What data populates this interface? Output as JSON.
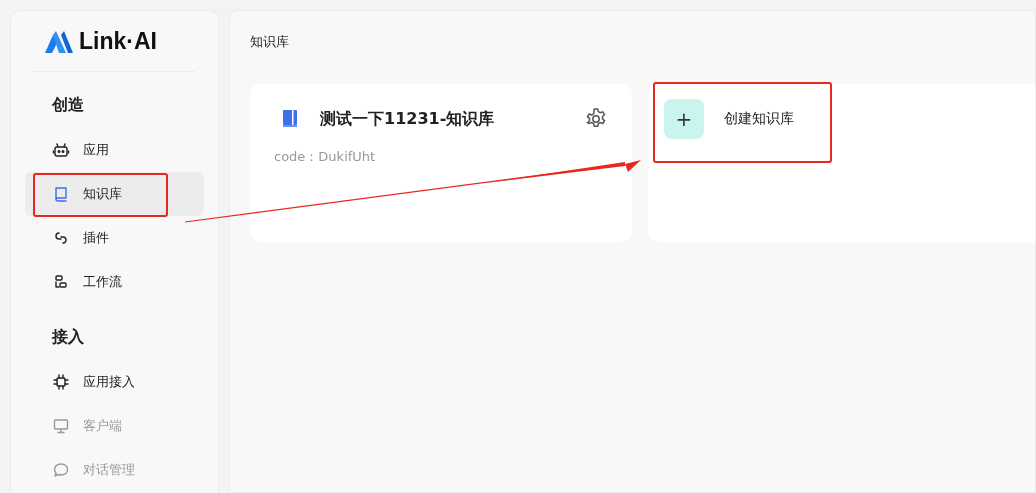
{
  "logo": {
    "text": "Link·AI"
  },
  "sidebar": {
    "sections": [
      {
        "title": "创造",
        "items": [
          {
            "label": "应用",
            "selected": false,
            "disabled": false,
            "highlighted": false
          },
          {
            "label": "知识库",
            "selected": true,
            "disabled": false,
            "highlighted": true
          },
          {
            "label": "插件",
            "selected": false,
            "disabled": false,
            "highlighted": false
          },
          {
            "label": "工作流",
            "selected": false,
            "disabled": false,
            "highlighted": false
          }
        ]
      },
      {
        "title": "接入",
        "items": [
          {
            "label": "应用接入",
            "selected": false,
            "disabled": false,
            "highlighted": false
          },
          {
            "label": "客户端",
            "selected": false,
            "disabled": true,
            "highlighted": false
          },
          {
            "label": "对话管理",
            "selected": false,
            "disabled": true,
            "highlighted": false
          }
        ]
      }
    ]
  },
  "page_title": "知识库",
  "knowledge_bases": [
    {
      "name": "测试一下11231-知识库",
      "code": "code：DukifUht"
    }
  ],
  "create_button": {
    "icon": "+",
    "label": "创建知识库",
    "highlighted": true
  },
  "annotation_arrow": true
}
